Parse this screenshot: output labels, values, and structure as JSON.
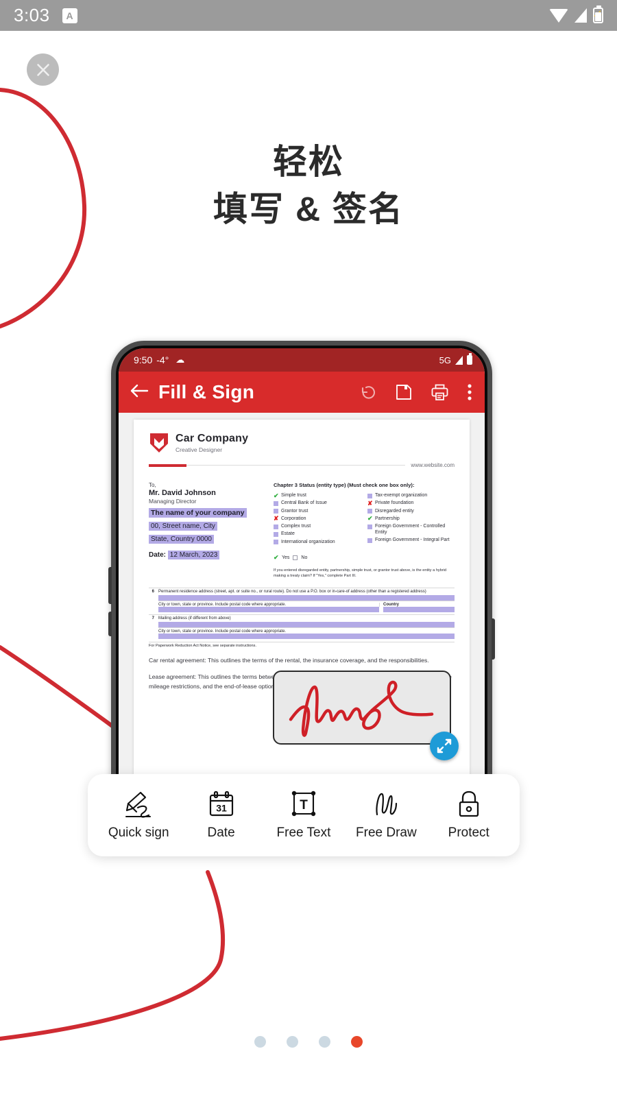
{
  "status_bar": {
    "time": "3:03",
    "app_badge": "A",
    "icons": [
      "wifi-icon",
      "cellular-signal-icon",
      "battery-charging-icon"
    ]
  },
  "close_button": {
    "icon": "close-icon",
    "label": "Close"
  },
  "headline": {
    "line1": "轻松",
    "line2": "填写 & 签名"
  },
  "phone": {
    "status_bar": {
      "time": "9:50",
      "temperature": "-4°",
      "weather_icon": "cloud-icon",
      "network": "5G",
      "icons": [
        "cellular-signal-icon",
        "battery-icon"
      ]
    },
    "app_bar": {
      "back_icon": "back-arrow-icon",
      "title": "Fill & Sign",
      "actions": [
        {
          "name": "undo-icon",
          "label": "Undo"
        },
        {
          "name": "save-icon",
          "label": "Save"
        },
        {
          "name": "print-icon",
          "label": "Print"
        },
        {
          "name": "more-options-icon",
          "label": "More options"
        }
      ]
    },
    "document": {
      "company_name": "Car Company",
      "company_tagline": "Creative Designer",
      "website": "www.website.com",
      "to_label": "To,",
      "recipient_name": "Mr. David Johnson",
      "recipient_role": "Managing Director",
      "filled_fields": [
        "The name of your company",
        "00, Street name, City",
        "State, Country 0000"
      ],
      "date_label": "Date:",
      "date_value": "12 March, 2023",
      "chapter_title": "Chapter 3 Status (entity type) (Must check one box only):",
      "checkbox_column_left": [
        {
          "label": "Simple trust",
          "state": "checked"
        },
        {
          "label": "Central Bank of Issue",
          "state": "empty"
        },
        {
          "label": "Grantor trust",
          "state": "empty"
        },
        {
          "label": "Corporation",
          "state": "crossed"
        },
        {
          "label": "Complex trust",
          "state": "empty"
        },
        {
          "label": "Estate",
          "state": "empty"
        },
        {
          "label": "International organization",
          "state": "empty"
        }
      ],
      "checkbox_column_right": [
        {
          "label": "Tax-exempt organization",
          "state": "empty"
        },
        {
          "label": "Private foundation",
          "state": "crossed"
        },
        {
          "label": "Disregarded entity",
          "state": "empty"
        },
        {
          "label": "Partnership",
          "state": "checked"
        },
        {
          "label": "Foreign Government - Controlled Entity",
          "state": "empty"
        },
        {
          "label": "Foreign Government - Integral Part",
          "state": "empty"
        }
      ],
      "yes_label": "Yes",
      "no_label": "No",
      "hybrid_note": "If you entered disregarded entity, partnership, simple trust, or grantor trust above, is the entity a hybrid making a treaty claim? If \"Yes,\" complete Part III.",
      "form_rows": [
        {
          "number": "6",
          "label": "Permanent residence address (street, apt. or suite no., or rural route). Do not use a P.O. box or in-care-of address  (other than a registered address)",
          "sub_label": "City or town, state or province. Include postal code where appropriate.",
          "country_label": "Country"
        },
        {
          "number": "7",
          "label": "Mailing address (if different from above)",
          "sub_label": "City or town, state or province. Include postal code where appropriate.",
          "country_label": ""
        }
      ],
      "paperwork_note": "For Paperwork Reduction Act Notice, see separate instructions.",
      "paragraphs": [
        "Car rental agreement: This outlines the terms of the rental, the insurance coverage, and the responsibilities.",
        "Lease agreement: This outlines the terms between a lessor and a lessee (the person who is leasing the vehicle), the mileage restrictions, and the end-of-lease options."
      ],
      "signature": {
        "name": "signature-annotation",
        "color": "#cf2027"
      },
      "resize_handle": {
        "name": "resize-handle-icon",
        "color": "#1e9bd7"
      }
    }
  },
  "toolbar": {
    "items": [
      {
        "icon": "quick-sign-icon",
        "label": "Quick sign"
      },
      {
        "icon": "calendar-icon",
        "label": "Date",
        "day": "31"
      },
      {
        "icon": "free-text-icon",
        "label": "Free Text",
        "glyph": "T"
      },
      {
        "icon": "free-draw-icon",
        "label": "Free Draw"
      },
      {
        "icon": "lock-icon",
        "label": "Protect"
      }
    ]
  },
  "pagination": {
    "total": 4,
    "active_index": 3,
    "active_color": "#e8472a",
    "inactive_color": "#ccd9e2"
  },
  "colors": {
    "brand_red": "#d82b2b",
    "decor_red": "#cf2b32",
    "highlight_purple": "#b3aae6",
    "accent_blue": "#1e9bd7"
  }
}
